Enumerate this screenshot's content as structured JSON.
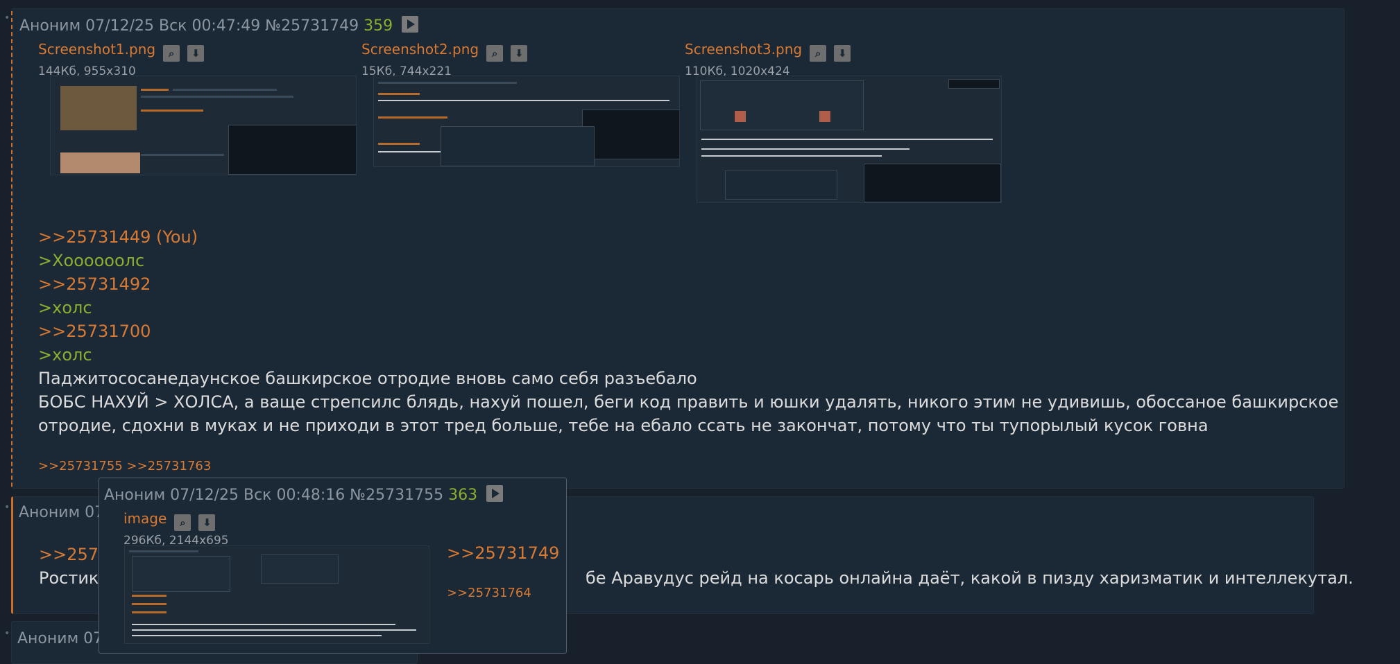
{
  "post1": {
    "author": "Аноним",
    "date": "07/12/25 Вск 00:47:49",
    "number": "№25731749",
    "reply_count": "359",
    "files": [
      {
        "name": "Screenshot1.png",
        "meta": "144Кб, 955x310"
      },
      {
        "name": "Screenshot2.png",
        "meta": "15Кб, 744x221"
      },
      {
        "name": "Screenshot3.png",
        "meta": "110Кб, 1020x424"
      }
    ],
    "lines": [
      ">>25731449 (You)",
      ">Хоооооолс",
      ">>25731492",
      ">холс",
      ">>25731700",
      ">холс",
      "Паджитососанедаунское башкирское отродие вновь само себя разъебало",
      "БОБС НАХУЙ > ХОЛСА, а ваще стрепсилс блядь, нахуй пошел, беги код править и юшки удалять, никого этим не удивишь, обоссаное башкирское",
      "отродие, сдохни в муках и не приходи в этот тред больше, тебе на ебало ссать не закончат, потому что ты тупорылый кусок говна"
    ],
    "replies": [
      ">>25731755",
      ">>25731763"
    ]
  },
  "post2": {
    "author_partial": "Аноним 07",
    "line1_partial": ">>2573",
    "line2_start": "Ростик,",
    "line2_end": "бе Аравудус рейд на косарь онлайна даёт, какой в пизду харизматик и интеллекутал."
  },
  "post3": {
    "author_partial": "Аноним 07"
  },
  "popup": {
    "author": "Аноним",
    "date": "07/12/25 Вск 00:48:16",
    "number": "№25731755",
    "reply_count": "363",
    "file_name": "image",
    "file_meta": "296Кб, 2144x695",
    "link1": ">>25731749",
    "link2": ">>25731764"
  },
  "icons": {
    "zoom": "magnifier-icon",
    "download": "download-icon",
    "play": "play-icon"
  },
  "colors": {
    "background": "#17202b",
    "post_bg": "#1b2836",
    "link": "#d97a32",
    "greentext": "#8dae2e",
    "header": "#8c96a0"
  }
}
